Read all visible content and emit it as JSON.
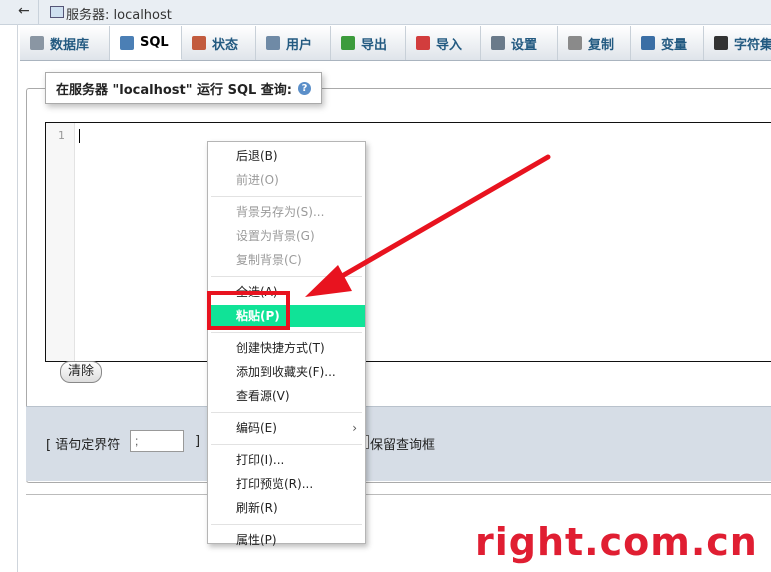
{
  "window": {
    "back_glyph": "←",
    "title": "服务器: localhost"
  },
  "tabs": [
    {
      "label": "数据库",
      "icon": "database-icon",
      "color": "#8a96a3"
    },
    {
      "label": "SQL",
      "icon": "sql-doc-icon",
      "color": "#4b7fb5"
    },
    {
      "label": "状态",
      "icon": "status-chart-icon",
      "color": "#c25b3e"
    },
    {
      "label": "用户",
      "icon": "users-icon",
      "color": "#6f8aa6"
    },
    {
      "label": "导出",
      "icon": "export-icon",
      "color": "#3c9b3c"
    },
    {
      "label": "导入",
      "icon": "import-icon",
      "color": "#d23d3d"
    },
    {
      "label": "设置",
      "icon": "wrench-icon",
      "color": "#6a7a8a"
    },
    {
      "label": "复制",
      "icon": "replication-icon",
      "color": "#8a8a8a"
    },
    {
      "label": "变量",
      "icon": "variables-icon",
      "color": "#3a6ea5"
    },
    {
      "label": "字符集",
      "icon": "charset-icon",
      "color": "#333333"
    }
  ],
  "query_panel": {
    "legend": "在服务器 \"localhost\" 运行 SQL 查询:",
    "help_glyph": "?"
  },
  "editor": {
    "line_number": "1",
    "content": ""
  },
  "clear_button": "清除",
  "options": {
    "delimiter_label": "[ 语句定界符",
    "delimiter_value": ";",
    "delimiter_close": "]",
    "keep_query_label": "保留查询框"
  },
  "context_menu": {
    "groups": [
      [
        {
          "label": "后退(B)",
          "disabled": false
        },
        {
          "label": "前进(O)",
          "disabled": true
        }
      ],
      [
        {
          "label": "背景另存为(S)...",
          "disabled": true
        },
        {
          "label": "设置为背景(G)",
          "disabled": true
        },
        {
          "label": "复制背景(C)",
          "disabled": true
        }
      ],
      [
        {
          "label": "全选(A)",
          "disabled": false
        },
        {
          "label": "粘贴(P)",
          "disabled": false,
          "highlighted": true
        }
      ],
      [
        {
          "label": "创建快捷方式(T)",
          "disabled": false
        },
        {
          "label": "添加到收藏夹(F)...",
          "disabled": false
        },
        {
          "label": "查看源(V)",
          "disabled": false
        }
      ],
      [
        {
          "label": "编码(E)",
          "disabled": false,
          "submenu": true
        }
      ],
      [
        {
          "label": "打印(I)...",
          "disabled": false
        },
        {
          "label": "打印预览(R)...",
          "disabled": false
        },
        {
          "label": "刷新(R)",
          "disabled": false
        }
      ],
      [
        {
          "label": "属性(P)",
          "disabled": false
        }
      ]
    ],
    "highlight_color": "#10e397"
  },
  "annotation": {
    "color": "#e8131f"
  },
  "watermark": "right.com.cn"
}
